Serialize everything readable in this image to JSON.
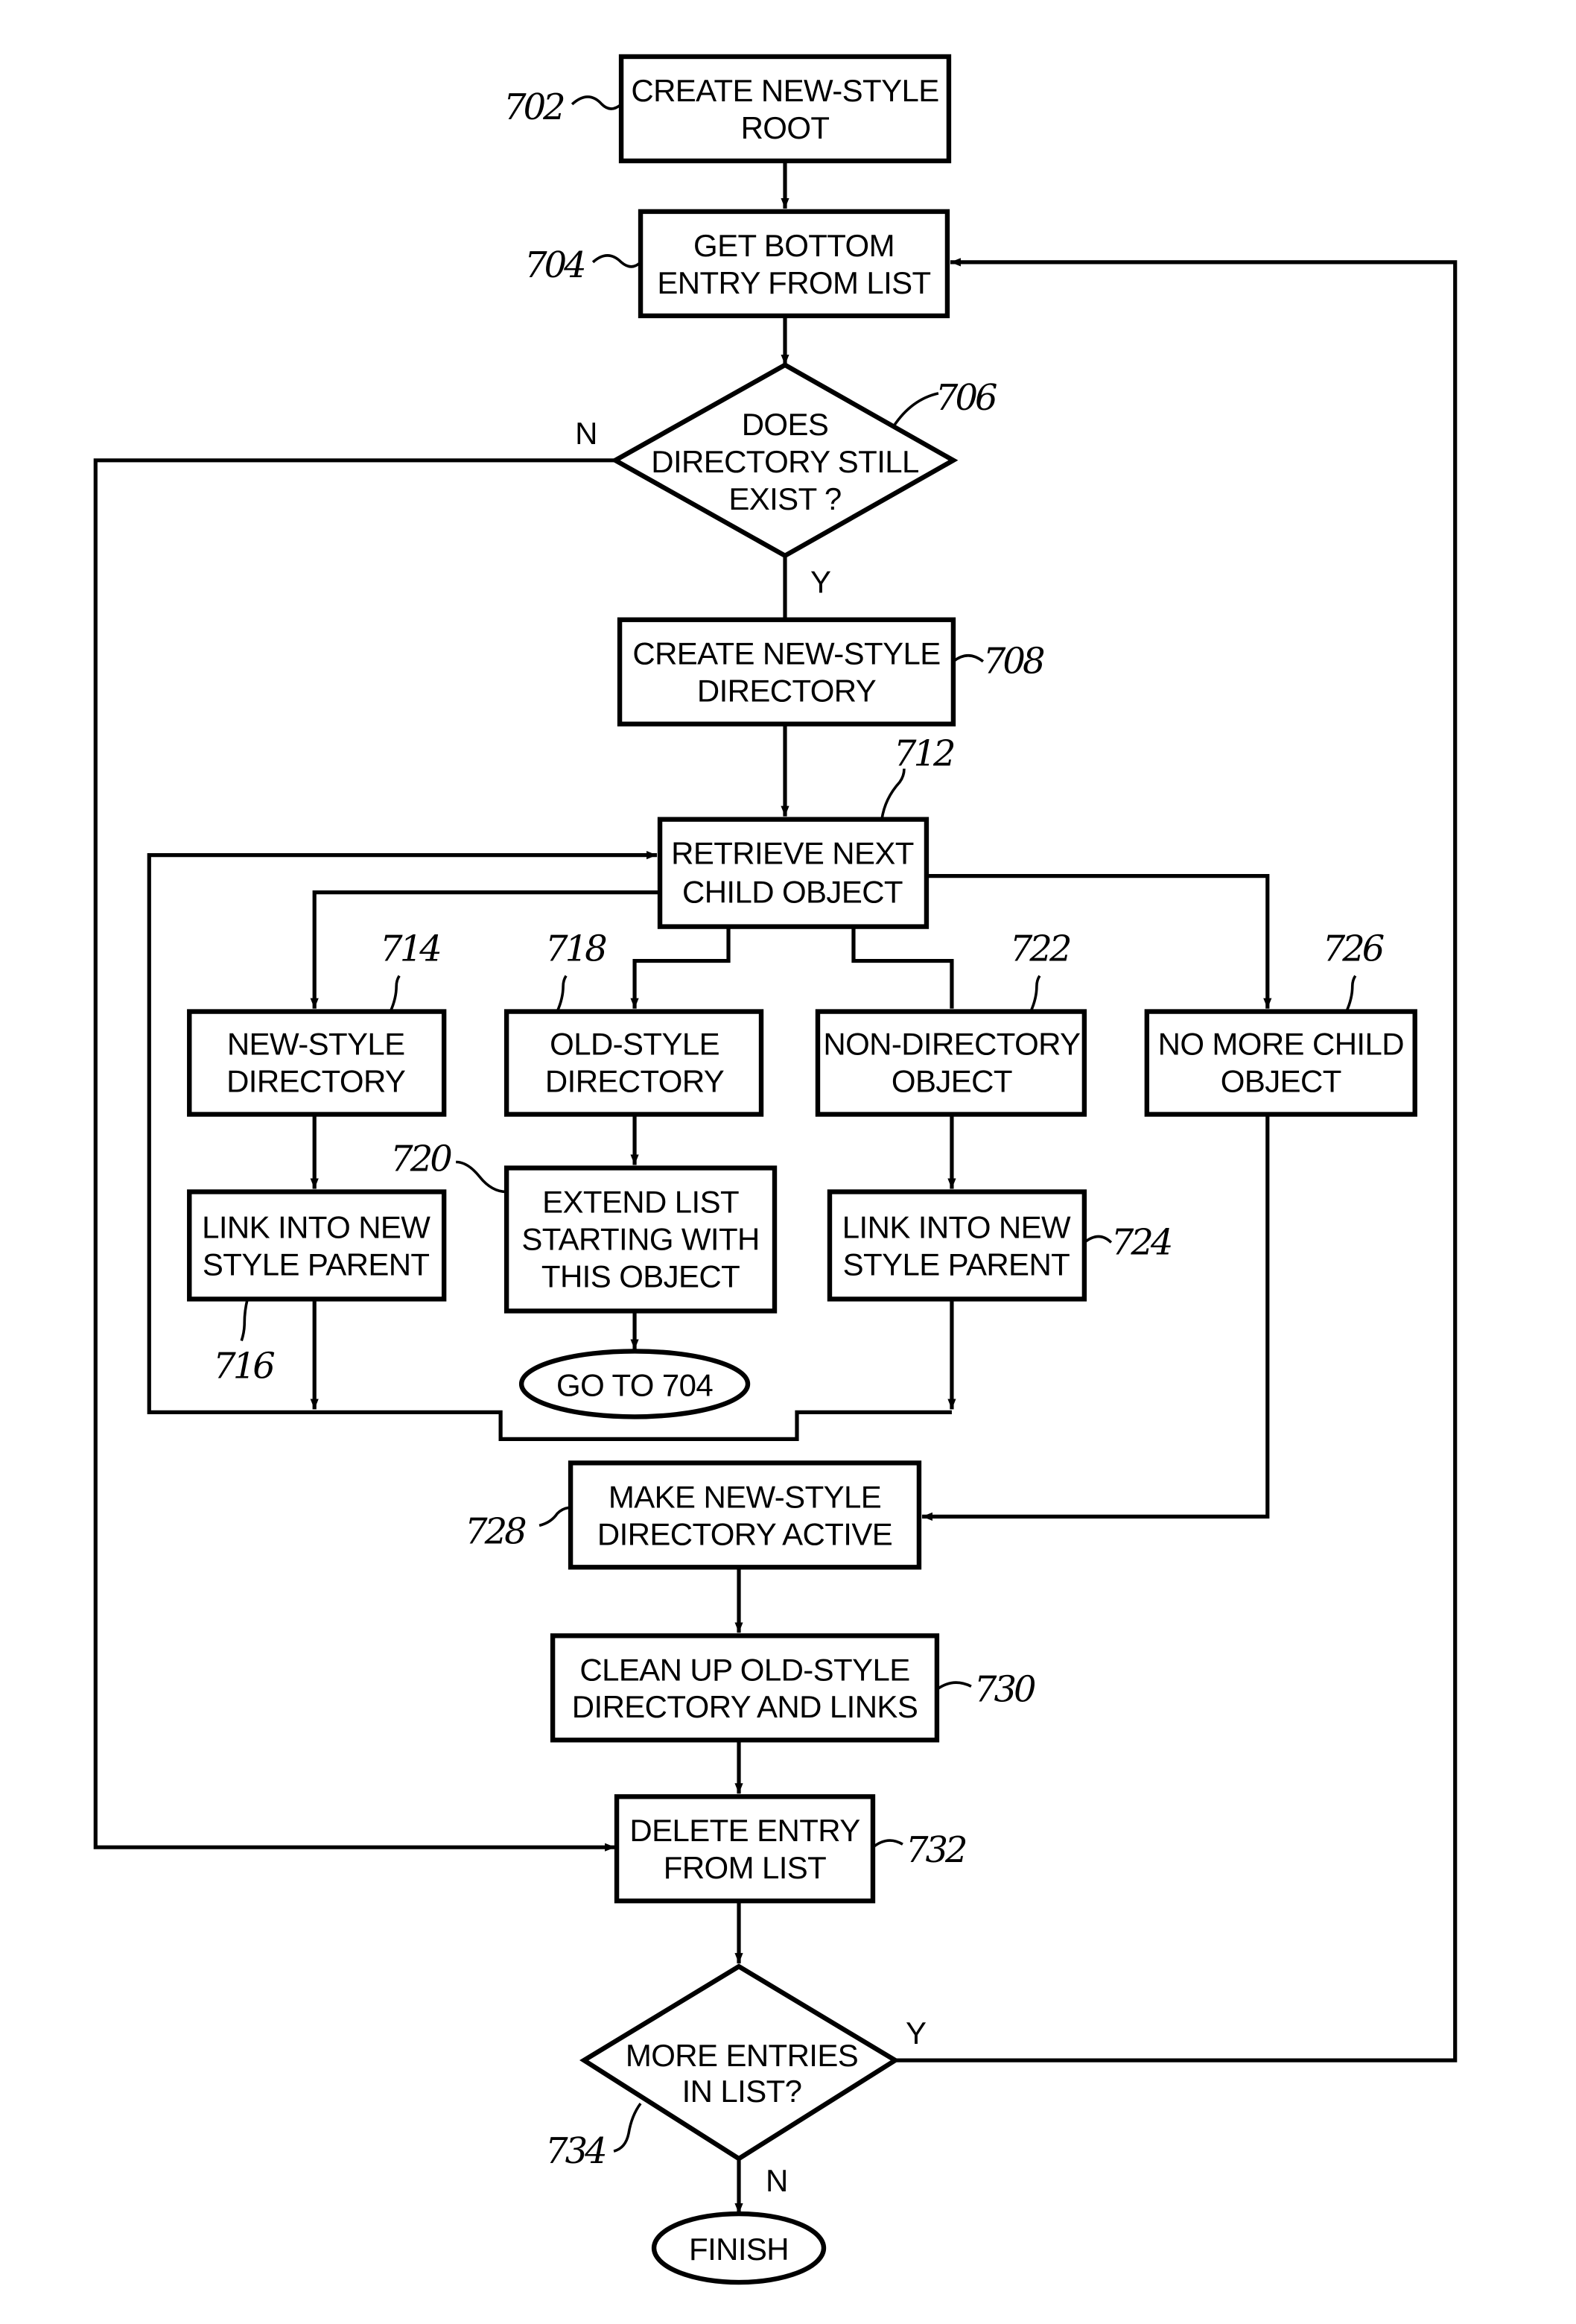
{
  "figure": {
    "type": "flowchart",
    "nodes": {
      "n702": {
        "ref": "702",
        "shape": "process",
        "lines": [
          "CREATE NEW-STYLE",
          "ROOT"
        ]
      },
      "n704": {
        "ref": "704",
        "shape": "process",
        "lines": [
          "GET BOTTOM",
          "ENTRY FROM LIST"
        ]
      },
      "n706": {
        "ref": "706",
        "shape": "decision",
        "lines": [
          "DOES",
          "DIRECTORY STILL",
          "EXIST ?"
        ]
      },
      "n708": {
        "ref": "708",
        "shape": "process",
        "lines": [
          "CREATE NEW-STYLE",
          "DIRECTORY"
        ]
      },
      "n712": {
        "ref": "712",
        "shape": "process",
        "lines": [
          "RETRIEVE NEXT",
          "CHILD OBJECT"
        ]
      },
      "n714": {
        "ref": "714",
        "shape": "process",
        "lines": [
          "NEW-STYLE",
          "DIRECTORY"
        ]
      },
      "n716": {
        "ref": "716",
        "shape": "process",
        "lines": [
          "LINK INTO NEW",
          "STYLE PARENT"
        ]
      },
      "n718": {
        "ref": "718",
        "shape": "process",
        "lines": [
          "OLD-STYLE",
          "DIRECTORY"
        ]
      },
      "n720": {
        "ref": "720",
        "shape": "process",
        "lines": [
          "EXTEND LIST",
          "STARTING WITH",
          "THIS OBJECT"
        ]
      },
      "goto": {
        "shape": "terminal",
        "lines": [
          "GO TO 704"
        ]
      },
      "n722": {
        "ref": "722",
        "shape": "process",
        "lines": [
          "NON-DIRECTORY",
          "OBJECT"
        ]
      },
      "n724": {
        "ref": "724",
        "shape": "process",
        "lines": [
          "LINK INTO NEW",
          "STYLE PARENT"
        ]
      },
      "n726": {
        "ref": "726",
        "shape": "process",
        "lines": [
          "NO MORE CHILD",
          "OBJECT"
        ]
      },
      "n728": {
        "ref": "728",
        "shape": "process",
        "lines": [
          "MAKE NEW-STYLE",
          "DIRECTORY ACTIVE"
        ]
      },
      "n730": {
        "ref": "730",
        "shape": "process",
        "lines": [
          "CLEAN UP OLD-STYLE",
          "DIRECTORY AND LINKS"
        ]
      },
      "n732": {
        "ref": "732",
        "shape": "process",
        "lines": [
          "DELETE ENTRY",
          "FROM LIST"
        ]
      },
      "n734": {
        "ref": "734",
        "shape": "decision",
        "lines": [
          "MORE ENTRIES",
          "IN LIST?"
        ]
      },
      "finish": {
        "shape": "terminal",
        "lines": [
          "FINISH"
        ]
      }
    },
    "edge_labels": {
      "d706_no": "N",
      "d706_yes": "Y",
      "d734_yes": "Y",
      "d734_no": "N"
    },
    "edges": [
      [
        "702",
        "704"
      ],
      [
        "704",
        "706"
      ],
      [
        "706",
        "708",
        "Y"
      ],
      [
        "706",
        "732",
        "N"
      ],
      [
        "708",
        "712"
      ],
      [
        "712",
        "714"
      ],
      [
        "712",
        "718"
      ],
      [
        "712",
        "722"
      ],
      [
        "712",
        "726"
      ],
      [
        "714",
        "716"
      ],
      [
        "718",
        "720"
      ],
      [
        "720",
        "GO TO 704"
      ],
      [
        "722",
        "724"
      ],
      [
        "716",
        "712"
      ],
      [
        "724",
        "712"
      ],
      [
        "726",
        "728"
      ],
      [
        "728",
        "730"
      ],
      [
        "730",
        "732"
      ],
      [
        "732",
        "734"
      ],
      [
        "734",
        "704",
        "Y"
      ],
      [
        "734",
        "FINISH",
        "N"
      ]
    ]
  }
}
